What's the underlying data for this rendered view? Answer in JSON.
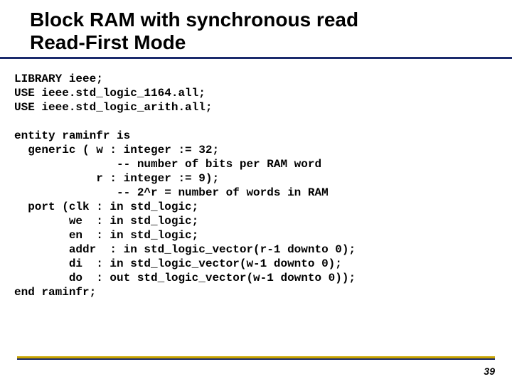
{
  "title_line1": "Block RAM with synchronous read",
  "title_line2": "Read-First Mode",
  "code": "LIBRARY ieee;\nUSE ieee.std_logic_1164.all;\nUSE ieee.std_logic_arith.all;\n\nentity raminfr is\n  generic ( w : integer := 32;\n               -- number of bits per RAM word\n            r : integer := 9);\n               -- 2^r = number of words in RAM\n  port (clk : in std_logic;\n        we  : in std_logic;\n        en  : in std_logic;\n        addr  : in std_logic_vector(r-1 downto 0);\n        di  : in std_logic_vector(w-1 downto 0);\n        do  : out std_logic_vector(w-1 downto 0));\nend raminfr;",
  "page_number": "39"
}
